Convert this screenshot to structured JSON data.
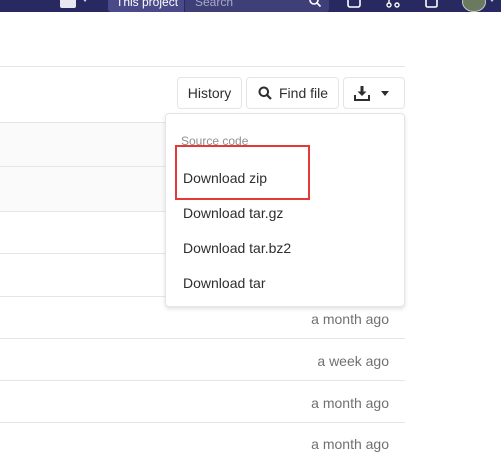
{
  "navbar": {
    "search_scope": "This project",
    "search_placeholder": "Search"
  },
  "toolbar": {
    "history_label": "History",
    "find_file_label": "Find file"
  },
  "download_menu": {
    "header": "Source code",
    "items": [
      {
        "label": "Download zip"
      },
      {
        "label": "Download tar.gz"
      },
      {
        "label": "Download tar.bz2"
      },
      {
        "label": "Download tar"
      }
    ]
  },
  "file_rows": [
    {
      "last_update": "a month ago"
    },
    {
      "last_update": "a week ago"
    },
    {
      "last_update": "a month ago"
    },
    {
      "last_update": "a month ago"
    }
  ],
  "colors": {
    "navbar": "#292961",
    "annotation": "#e53935"
  }
}
